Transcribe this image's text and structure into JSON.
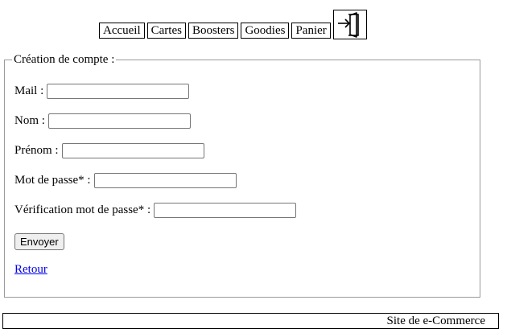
{
  "nav": {
    "items": [
      {
        "label": "Accueil"
      },
      {
        "label": "Cartes"
      },
      {
        "label": "Boosters"
      },
      {
        "label": "Goodies"
      },
      {
        "label": "Panier"
      }
    ],
    "login_icon": "sign-in-icon"
  },
  "form": {
    "legend": "Création de compte :",
    "fields": [
      {
        "label": "Mail :",
        "value": ""
      },
      {
        "label": "Nom :",
        "value": ""
      },
      {
        "label": "Prénom :",
        "value": ""
      },
      {
        "label": "Mot de passe* :",
        "value": ""
      },
      {
        "label": "Vérification mot de passe* :",
        "value": ""
      }
    ],
    "submit_label": "Envoyer",
    "back_link": "Retour"
  },
  "footer": {
    "text": "Site de e-Commerce"
  }
}
